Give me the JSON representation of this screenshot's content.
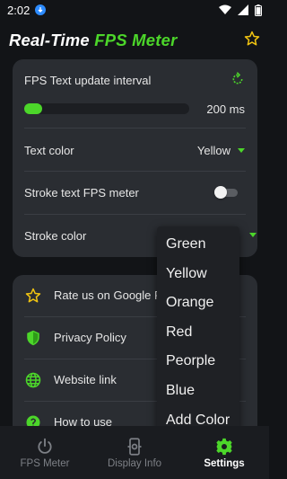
{
  "status_bar": {
    "time": "2:02"
  },
  "app": {
    "title_white": "Real-Time ",
    "title_green": "FPS Meter"
  },
  "settings": {
    "fps_interval_label": "FPS Text update interval",
    "fps_interval_value": "200 ms",
    "fps_interval_fill_fraction": 0.11,
    "text_color_label": "Text color",
    "text_color_value": "Yellow",
    "stroke_label": "Stroke text FPS meter",
    "stroke_enabled": false,
    "stroke_color_label": "Stroke color"
  },
  "links": [
    {
      "label": "Rate us on Google P",
      "icon": "star-icon"
    },
    {
      "label": "Privacy Policy",
      "icon": "shield-icon"
    },
    {
      "label": "Website link",
      "icon": "globe-icon"
    },
    {
      "label": "How to use",
      "icon": "help-icon"
    }
  ],
  "dropdown": {
    "options": [
      "Green",
      "Yellow",
      "Orange",
      "Red",
      "Peorple",
      "Blue",
      "Add Color"
    ]
  },
  "bottom_nav": [
    {
      "label": "FPS Meter",
      "icon": "power-icon",
      "active": false
    },
    {
      "label": "Display Info",
      "icon": "phone-settings-icon",
      "active": false
    },
    {
      "label": "Settings",
      "icon": "gear-icon",
      "active": true
    }
  ],
  "colors": {
    "accent": "#4cd62a",
    "background": "#121417",
    "card": "#2a2d32",
    "star": "#f2c511"
  }
}
